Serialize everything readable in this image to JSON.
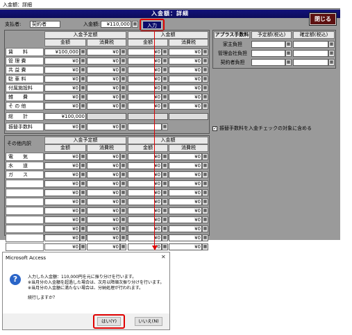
{
  "window_title": "入金額：詳細",
  "banner": "入金額：詳細",
  "close_label": "閉じる",
  "header": {
    "payer_label": "支払者:",
    "payer_value": "契約者",
    "amount_label": "入金額:",
    "amount_value": "¥110,000",
    "input_label": "入力"
  },
  "main_table": {
    "group1": "入金予定額",
    "group2": "入金額",
    "col_amount": "金額",
    "col_tax": "消費税",
    "rows": [
      {
        "label": "賃　　料",
        "a1": "¥100,000",
        "t1": "¥0",
        "a2": "¥0",
        "t2": "¥0"
      },
      {
        "label": "管 理 費",
        "a1": "¥0",
        "t1": "¥0",
        "a2": "¥0",
        "t2": "¥0"
      },
      {
        "label": "共 益 費",
        "a1": "¥0",
        "t1": "¥0",
        "a2": "¥0",
        "t2": "¥0"
      },
      {
        "label": "駐 車 料",
        "a1": "¥0",
        "t1": "¥0",
        "a2": "¥0",
        "t2": "¥0"
      },
      {
        "label": "付属施設料",
        "a1": "¥0",
        "t1": "¥0",
        "a2": "¥0",
        "t2": "¥0"
      },
      {
        "label": "雑　　費",
        "a1": "¥0",
        "t1": "¥0",
        "a2": "¥0",
        "t2": "¥0"
      },
      {
        "label": "そ の 他",
        "a1": "¥0",
        "t1": "¥0",
        "a2": "¥0",
        "t2": "¥0"
      }
    ],
    "total_label": "総　　計",
    "total_a1": "¥100,000",
    "transfer_label": "振替手数料",
    "transfer_a1": "¥0",
    "transfer_t1": "¥0"
  },
  "fee_table": {
    "title": "アプラス手数料",
    "col1": "予定額(税込)",
    "col2": "確定額(税込)",
    "rows": [
      "家主負担",
      "管理会社負担",
      "契約者負担"
    ]
  },
  "checkbox_label": "振替手数料を入金チェックの対象に含める",
  "other_table": {
    "title": "その他内訳",
    "group1": "入金予定額",
    "group2": "入金額",
    "col_amount": "金額",
    "col_tax": "消費税",
    "rows": [
      {
        "label": "電　　気",
        "a1": "¥0",
        "t1": "¥0",
        "a2": "¥0",
        "t2": "¥0"
      },
      {
        "label": "水　　道",
        "a1": "¥0",
        "t1": "¥0",
        "a2": "¥0",
        "t2": "¥0"
      },
      {
        "label": "ガ　　ス",
        "a1": "¥0",
        "t1": "¥0",
        "a2": "¥0",
        "t2": "¥0"
      },
      {
        "label": "",
        "a1": "¥0",
        "t1": "¥0",
        "a2": "¥0",
        "t2": "¥0"
      },
      {
        "label": "",
        "a1": "¥0",
        "t1": "¥0",
        "a2": "¥0",
        "t2": "¥0"
      },
      {
        "label": "",
        "a1": "¥0",
        "t1": "¥0",
        "a2": "¥0",
        "t2": "¥0"
      },
      {
        "label": "",
        "a1": "¥0",
        "t1": "¥0",
        "a2": "¥0",
        "t2": "¥0"
      },
      {
        "label": "",
        "a1": "¥0",
        "t1": "¥0",
        "a2": "¥0",
        "t2": "¥0"
      },
      {
        "label": "",
        "a1": "¥0",
        "t1": "¥0",
        "a2": "¥0",
        "t2": "¥0"
      },
      {
        "label": "",
        "a1": "¥0",
        "t1": "¥0",
        "a2": "¥0",
        "t2": "¥0"
      },
      {
        "label": "",
        "a1": "¥0",
        "t1": "¥0",
        "a2": "¥0",
        "t2": "¥0"
      }
    ]
  },
  "dialog": {
    "title": "Microsoft Access",
    "line1": "入力した入金額：110,000円を元に振り分けを行います。",
    "line2": "※当月分の入金額を超過した場合は、次月以降順次振り分けを行います。",
    "line3": "※当月分の入金額に満たない場合は、分納処理が行われます。",
    "line4": "続行しますか？",
    "yes": "はい(Y)",
    "no": "いいえ(N)"
  },
  "calc_icon": "calculator-icon",
  "colors": {
    "banner": "#0c0c5a",
    "close": "#5c1010",
    "highlight": "#e00000",
    "form_bg": "#9a9a9a"
  }
}
